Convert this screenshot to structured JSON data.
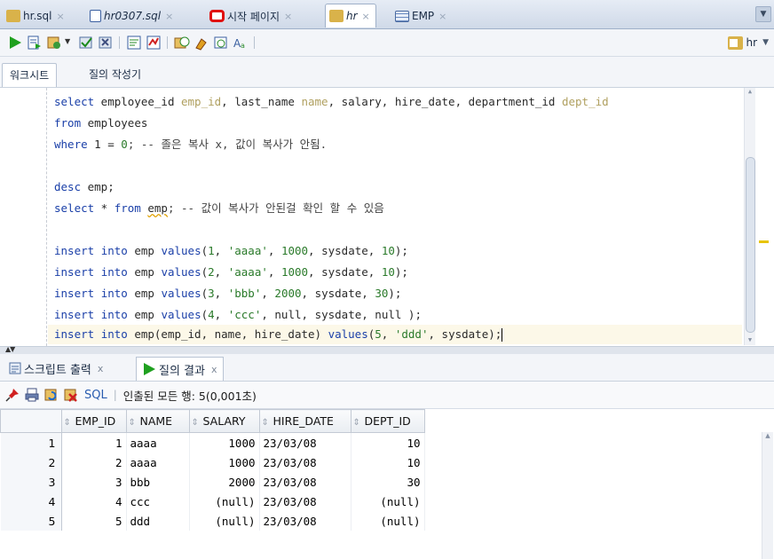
{
  "tabs": [
    {
      "label": "hr.sql",
      "icon": "sql-db-icon",
      "active": false
    },
    {
      "label": "hr0307.sql",
      "icon": "sql-file-icon",
      "active": false
    },
    {
      "label": "시작 페이지",
      "icon": "oracle-icon",
      "active": false
    },
    {
      "label": "hr",
      "icon": "sql-db-icon",
      "active": true
    },
    {
      "label": "EMP",
      "icon": "table-icon",
      "active": false
    }
  ],
  "connection": {
    "label": "hr"
  },
  "editor_tabs": {
    "worksheet": "워크시트",
    "query_builder": "질의 작성기"
  },
  "code": {
    "l1": {
      "kw1": "select",
      "t1": " employee_id ",
      "a1": "emp_id",
      "t2": ", last_name ",
      "a2": "name",
      "t3": ", salary, hire_date, department_id ",
      "a3": "dept_id"
    },
    "l2": {
      "kw": "from",
      "t": " employees"
    },
    "l3": {
      "kw": "where",
      "t1": " 1 = ",
      "n": "0",
      "t2": "; -- 졸은 복사 x, 값이 복사가 안됨."
    },
    "l4": {
      "kw": "desc",
      "t": " emp;"
    },
    "l5": {
      "kw1": "select",
      "t1": " * ",
      "kw2": "from",
      "t2": " ",
      "sq": "emp",
      "t3": "; -- 값이 복사가 안된걸 확인 할 수 있음"
    },
    "ins": {
      "kw": "insert",
      "kw2": "into",
      "kw3": "values",
      "null": "null",
      "sysdate": "sysdate"
    },
    "l6": {
      "tbl": " emp ",
      "args": "(",
      "n1": "1",
      "c1": ", ",
      "s": "'aaaa'",
      "c2": ", ",
      "n2": "1000",
      "c3": ", sysdate, ",
      "n3": "10",
      "end": ");"
    },
    "l7": {
      "tbl": " emp ",
      "args": "(",
      "n1": "2",
      "c1": ", ",
      "s": "'aaaa'",
      "c2": ", ",
      "n2": "1000",
      "c3": ", sysdate, ",
      "n3": "10",
      "end": ");"
    },
    "l8": {
      "tbl": " emp ",
      "args": "(",
      "n1": "3",
      "c1": ", ",
      "s": "'bbb'",
      "c2": ", ",
      "n2": "2000",
      "c3": ", sysdate, ",
      "n3": "30",
      "end": ");"
    },
    "l9": {
      "tbl": " emp ",
      "args": "(",
      "n1": "4",
      "c1": ", ",
      "s": "'ccc'",
      "c2": ", null, sysdate, null );"
    },
    "l10": {
      "pre": " emp(emp_id, name, hire_date) ",
      "args": "(",
      "n1": "5",
      "c1": ", ",
      "s": "'ddd'",
      "c2": ", sysdate);"
    }
  },
  "output_tabs": {
    "script_output": "스크립트 출력",
    "query_result": "질의 결과"
  },
  "result_toolbar": {
    "sql_label": "SQL",
    "status": "인출된 모든 행: 5(0,001초)"
  },
  "result": {
    "columns": [
      "EMP_ID",
      "NAME",
      "SALARY",
      "HIRE_DATE",
      "DEPT_ID"
    ],
    "rows": [
      {
        "n": "1",
        "emp_id": "1",
        "name": "aaaa",
        "salary": "1000",
        "hire_date": "23/03/08",
        "dept_id": "10"
      },
      {
        "n": "2",
        "emp_id": "2",
        "name": "aaaa",
        "salary": "1000",
        "hire_date": "23/03/08",
        "dept_id": "10"
      },
      {
        "n": "3",
        "emp_id": "3",
        "name": "bbb",
        "salary": "2000",
        "hire_date": "23/03/08",
        "dept_id": "30"
      },
      {
        "n": "4",
        "emp_id": "4",
        "name": "ccc",
        "salary": "(null)",
        "hire_date": "23/03/08",
        "dept_id": "(null)"
      },
      {
        "n": "5",
        "emp_id": "5",
        "name": "ddd",
        "salary": "(null)",
        "hire_date": "23/03/08",
        "dept_id": "(null)"
      }
    ]
  }
}
